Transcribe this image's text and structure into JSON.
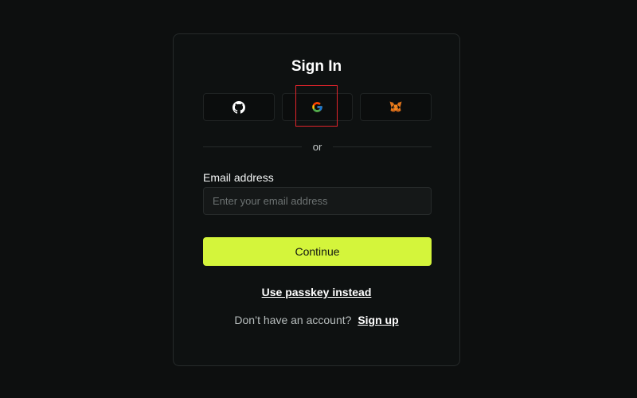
{
  "signin": {
    "title": "Sign In",
    "social_providers": [
      {
        "name": "github",
        "icon": "github-icon"
      },
      {
        "name": "google",
        "icon": "google-icon"
      },
      {
        "name": "metamask",
        "icon": "metamask-fox-icon"
      }
    ],
    "divider_text": "or",
    "email_label": "Email address",
    "email_placeholder": "Enter your email address",
    "email_value": "",
    "continue_label": "Continue",
    "passkey_label": "Use passkey instead",
    "no_account_text": "Don’t have an account?",
    "signup_label": "Sign up"
  },
  "colors": {
    "background": "#0d0f0f",
    "card": "#0e1111",
    "accent": "#d4f53b",
    "highlight": "#e0242b"
  }
}
